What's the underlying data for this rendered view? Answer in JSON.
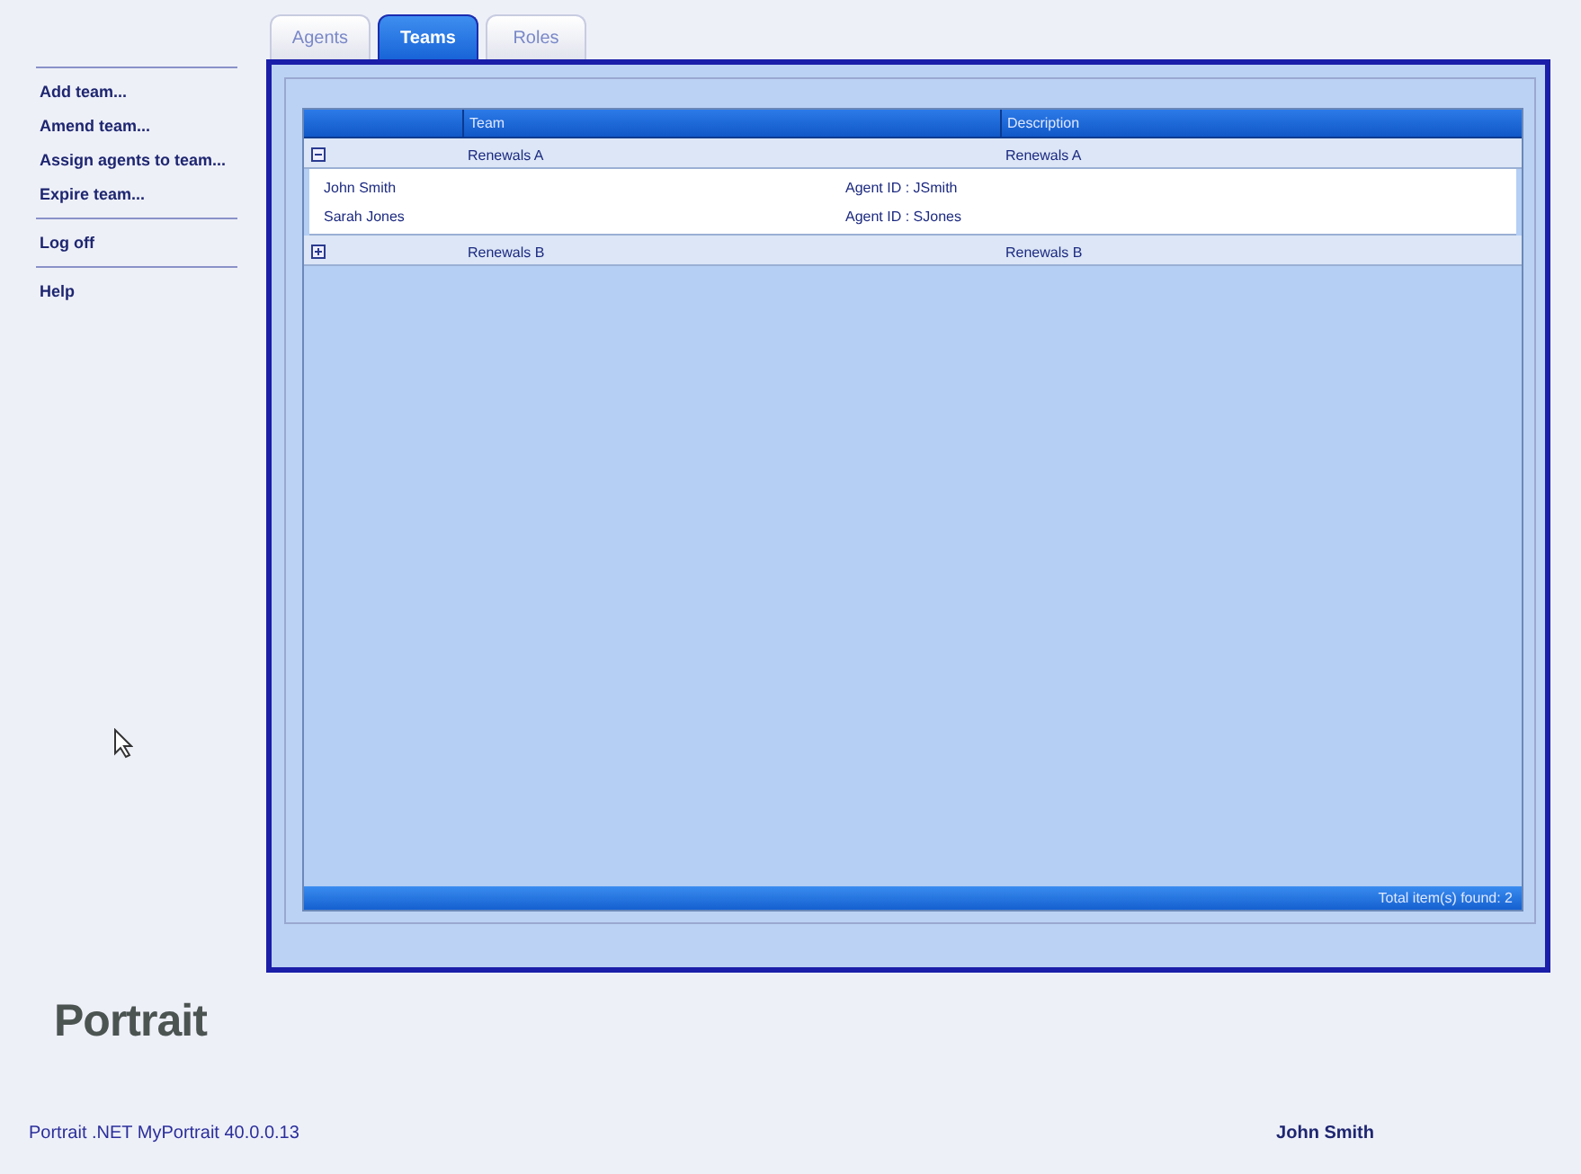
{
  "tabs": [
    {
      "label": "Agents",
      "selected": false
    },
    {
      "label": "Teams",
      "selected": true
    },
    {
      "label": "Roles",
      "selected": false
    }
  ],
  "sidebar": {
    "groups": [
      {
        "items": [
          "Add team...",
          "Amend team...",
          "Assign agents to team...",
          "Expire team..."
        ]
      },
      {
        "items": [
          "Log off"
        ]
      },
      {
        "items": [
          "Help"
        ]
      }
    ]
  },
  "logo": "Portrait",
  "table": {
    "columns": [
      "Team",
      "Description"
    ],
    "rows": [
      {
        "team": "Renewals A",
        "description": "Renewals A",
        "expanded": true,
        "children": [
          {
            "name": "John Smith",
            "detail": "Agent ID : JSmith"
          },
          {
            "name": "Sarah Jones",
            "detail": "Agent ID : SJones"
          }
        ]
      },
      {
        "team": "Renewals B",
        "description": "Renewals B",
        "expanded": false,
        "children": []
      }
    ],
    "footer": "Total item(s) found: 2"
  },
  "status_bar": {
    "version": "Portrait .NET MyPortrait 40.0.0.13",
    "user": "John Smith"
  }
}
